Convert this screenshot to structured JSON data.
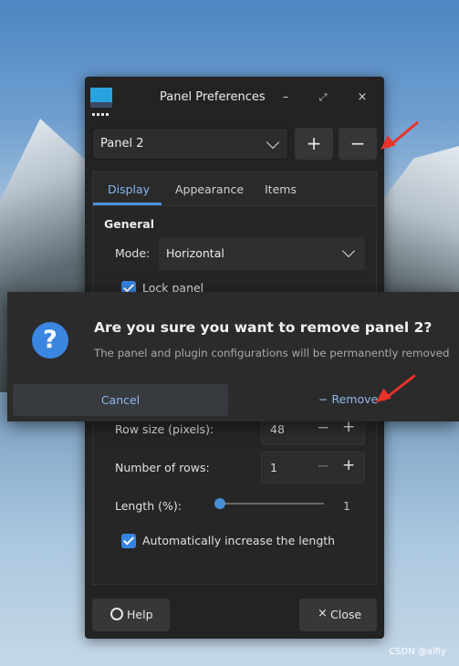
{
  "window": {
    "title": "Panel Preferences",
    "minimize_glyph": "–",
    "maximize_glyph": "⤢",
    "close_glyph": "×"
  },
  "panel_select": {
    "value": "Panel 2"
  },
  "add_panel": {
    "glyph": "+"
  },
  "remove_panel": {
    "glyph": "−"
  },
  "tabs": [
    {
      "label": "Display",
      "active": true
    },
    {
      "label": "Appearance",
      "active": false
    },
    {
      "label": "Items",
      "active": false
    }
  ],
  "general": {
    "title": "General",
    "mode_label": "Mode:",
    "mode_value": "Horizontal",
    "lock_panel_label": "Lock panel",
    "lock_panel_checked": true
  },
  "measurements": {
    "row_size_label": "Row size (pixels):",
    "row_size_value": "48",
    "rows_label": "Number of rows:",
    "rows_value": "1",
    "length_label": "Length (%):",
    "length_value": "1",
    "auto_increase_label": "Automatically increase the length",
    "auto_increase_checked": true
  },
  "bottom": {
    "help_label": "Help",
    "close_label": "Close"
  },
  "dialog": {
    "icon": "?",
    "title": "Are you sure you want to remove panel 2?",
    "body": "The panel and plugin configurations will be permanently removed",
    "cancel_label": "Cancel",
    "remove_label": "Remove",
    "remove_glyph": "−"
  },
  "watermark": "CSDN @alfiy",
  "colors": {
    "accent": "#3584e4",
    "annotation_arrow": "#e8332b",
    "window_bg": "#232323"
  }
}
